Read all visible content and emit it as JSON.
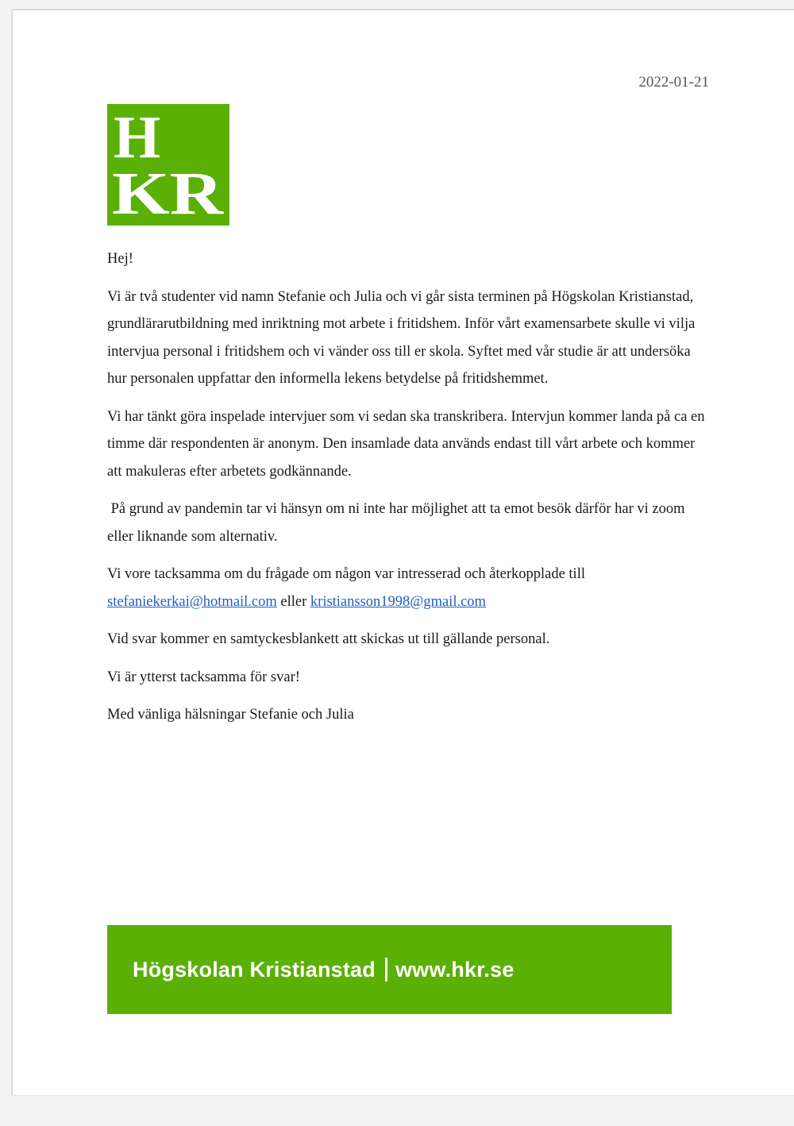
{
  "letter": {
    "date": "2022-01-21",
    "logo": {
      "line1": "H",
      "line2": "KR",
      "color": "#5ab004"
    },
    "greeting": "Hej!",
    "paragraph1": "Vi är två studenter vid namn Stefanie och Julia och vi går sista terminen på Högskolan Kristianstad, grundlärarutbildning med inriktning mot arbete i fritidshem. Inför vårt examensarbete skulle vi vilja intervjua personal i fritidshem och vi vänder oss till er skola. Syftet med vår studie är att undersöka hur personalen uppfattar den informella lekens betydelse på fritidshemmet.",
    "paragraph2": "Vi har tänkt göra inspelade intervjuer som vi sedan ska transkribera. Intervjun kommer landa på ca en timme där respondenten är anonym. Den insamlade data används endast till vårt arbete och kommer att makuleras efter arbetets godkännande.",
    "paragraph3": " På grund av pandemin tar vi hänsyn om ni inte har möjlighet att ta emot besök därför har vi zoom eller liknande som alternativ.",
    "paragraph4_text": "Vi vore tacksamma om du frågade om någon var intresserad och återkopplade till",
    "email1": "stefaniekerkai@hotmail.com",
    "connector": "eller",
    "email2": "kristiansson1998@gmail.com",
    "paragraph5": "Vid svar kommer en samtyckesblankett att skickas ut till gällande personal.",
    "paragraph6": "Vi är ytterst tacksamma för svar!",
    "closing": "Med vänliga hälsningar Stefanie och Julia"
  },
  "footer": {
    "org_name": "Högskolan Kristianstad",
    "website": "www.hkr.se",
    "color": "#5ab004"
  }
}
